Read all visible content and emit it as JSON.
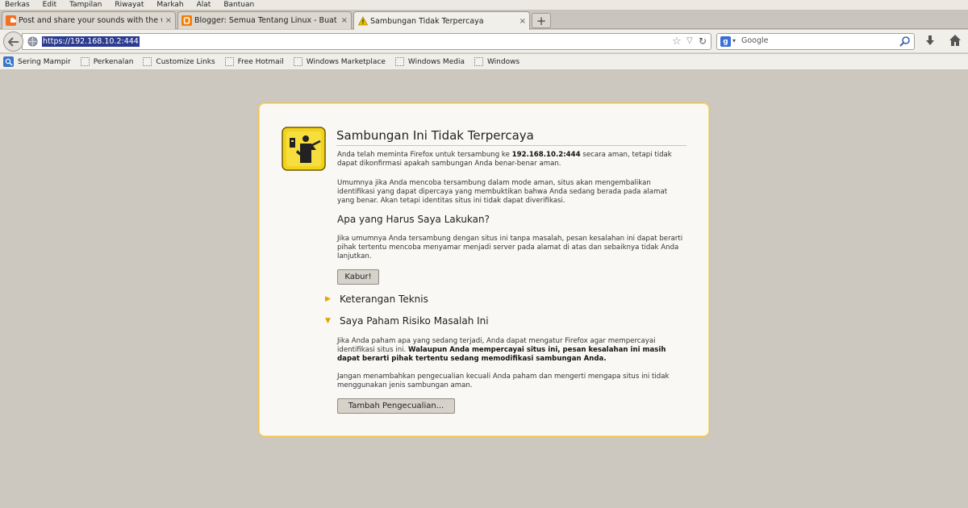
{
  "menu": [
    "Berkas",
    "Edit",
    "Tampilan",
    "Riwayat",
    "Markah",
    "Alat",
    "Bantuan"
  ],
  "tabs": [
    {
      "label": "Post and share your sounds with the wor...",
      "icon": "soundcloud-icon",
      "close": "×"
    },
    {
      "label": "Blogger: Semua Tentang Linux - Buat entri",
      "icon": "blogger-icon",
      "close": "×"
    },
    {
      "label": "Sambungan Tidak Terpercaya",
      "icon": "warning-icon",
      "close": "×"
    }
  ],
  "newtab_label": "+",
  "url": "https://192.168.10.2:444",
  "search": {
    "placeholder": "Google",
    "engine_letter": "g"
  },
  "bookmarks": [
    "Sering Mampir",
    "Perkenalan",
    "Customize Links",
    "Free Hotmail",
    "Windows Marketplace",
    "Windows Media",
    "Windows"
  ],
  "error": {
    "title": "Sambungan Ini Tidak Terpercaya",
    "p1_a": "Anda telah meminta Firefox untuk tersambung ke ",
    "p1_host": "192.168.10.2:444",
    "p1_b": " secara aman, tetapi tidak dapat dikonfirmasi apakah sambungan Anda benar-benar aman.",
    "p2": "Umumnya jika Anda mencoba tersambung dalam mode aman, situs akan mengembalikan identifikasi yang dapat dipercaya yang membuktikan bahwa Anda sedang berada pada alamat yang benar. Akan tetapi identitas situs ini tidak dapat diverifikasi.",
    "h_what": "Apa yang Harus Saya Lakukan?",
    "p3": "Jika umumnya Anda tersambung dengan situs ini tanpa masalah, pesan kesalahan ini dapat berarti pihak tertentu mencoba menyamar menjadi server pada alamat di atas dan sebaiknya tidak Anda lanjutkan.",
    "escape_button": "Kabur!",
    "technical": "Keterangan Teknis",
    "risks": "Saya Paham Risiko Masalah Ini",
    "p4_a": "Jika Anda paham apa yang sedang terjadi, Anda dapat mengatur Firefox agar mempercayai identifikasi situs ini. ",
    "p4_bold": "Walaupun Anda mempercayai situs ini, pesan kesalahan ini masih dapat berarti pihak tertentu sedang memodifikasi sambungan Anda.",
    "p5": "Jangan menambahkan pengecualian kecuali Anda paham dan mengerti mengapa situs ini tidak menggunakan jenis sambungan aman.",
    "exception_button": "Tambah Pengecualian..."
  },
  "colors": {
    "accent_border": "#f0c24a",
    "icon_yellow": "#f2d21b",
    "url_highlight": "#2b3b8f"
  }
}
